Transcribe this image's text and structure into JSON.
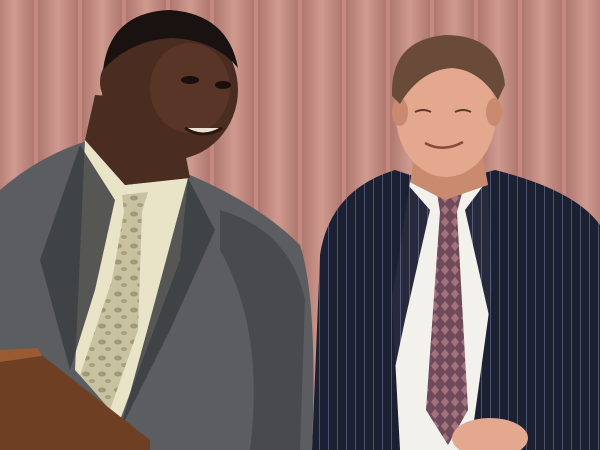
{
  "scene": {
    "curtain_base": "#c48a80",
    "curtain_light": "#d9a79b",
    "curtain_shadow": "#9e6a62",
    "left_suit": "#5b5d60",
    "left_suit_shadow": "#3c3e41",
    "left_shirt": "#e9e4c8",
    "left_tie": "#c9c2a0",
    "left_tie_pattern": "#8f8866",
    "left_skin": "#4a2c20",
    "left_skin_highlight": "#6b4030",
    "right_suit": "#1c2033",
    "right_suit_stripe": "#4c5270",
    "right_shirt": "#f3f1ec",
    "right_tie": "#6e4a5a",
    "right_tie_pattern": "#b07d86",
    "right_skin": "#e3a88e",
    "right_skin_shadow": "#c98a70",
    "right_hair": "#6a4a38",
    "left_hair": "#1a1210",
    "podium": "#6e3f22",
    "podium_highlight": "#9a5a32"
  }
}
